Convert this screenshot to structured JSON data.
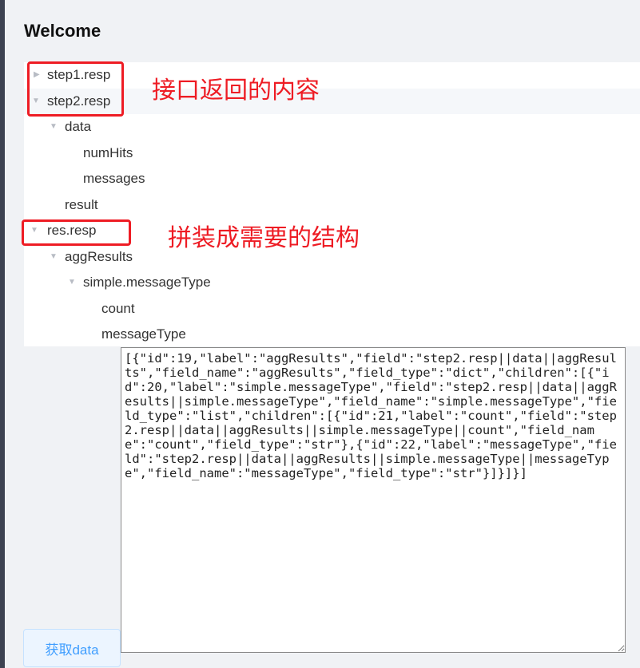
{
  "page": {
    "title": "Welcome"
  },
  "tree": [
    {
      "label": "step1.resp",
      "arrow": "▶",
      "expanded": false
    },
    {
      "label": "step2.resp",
      "arrow": "▼",
      "expanded": true
    },
    {
      "label": "data",
      "arrow": "▼",
      "expanded": true
    },
    {
      "label": "numHits",
      "arrow": ""
    },
    {
      "label": "messages",
      "arrow": ""
    },
    {
      "label": "result",
      "arrow": ""
    },
    {
      "label": "res.resp",
      "arrow": "▼",
      "expanded": true
    },
    {
      "label": "aggResults",
      "arrow": "▼",
      "expanded": true
    },
    {
      "label": "simple.messageType",
      "arrow": "▼",
      "expanded": true
    },
    {
      "label": "count",
      "arrow": ""
    },
    {
      "label": "messageType",
      "arrow": ""
    }
  ],
  "annotations": {
    "interface_content": "接口返回的内容",
    "assembled_structure": "拼装成需要的结构",
    "color": "#ee1c24"
  },
  "json_output": "[{\"id\":19,\"label\":\"aggResults\",\"field\":\"step2.resp||data||aggResults\",\"field_name\":\"aggResults\",\"field_type\":\"dict\",\"children\":[{\"id\":20,\"label\":\"simple.messageType\",\"field\":\"step2.resp||data||aggResults||simple.messageType\",\"field_name\":\"simple.messageType\",\"field_type\":\"list\",\"children\":[{\"id\":21,\"label\":\"count\",\"field\":\"step2.resp||data||aggResults||simple.messageType||count\",\"field_name\":\"count\",\"field_type\":\"str\"},{\"id\":22,\"label\":\"messageType\",\"field\":\"step2.resp||data||aggResults||simple.messageType||messageType\",\"field_name\":\"messageType\",\"field_type\":\"str\"}]}]}]",
  "buttons": {
    "fetch_label": "获取data"
  },
  "colors": {
    "primary": "#409eff",
    "highlight_row": "#f5f7fa",
    "sidebar": "#3d4251"
  }
}
